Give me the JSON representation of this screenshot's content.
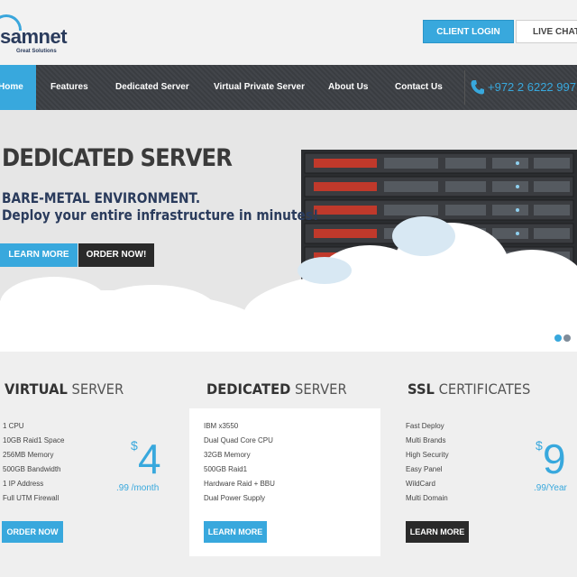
{
  "brand": {
    "name": "samnet",
    "tagline": "Great Solutions"
  },
  "header": {
    "client_login": "CLIENT LOGIN",
    "live_chat": "LIVE CHAT"
  },
  "nav": {
    "items": [
      "Home",
      "Features",
      "Dedicated Server",
      "Virtual Private Server",
      "About Us",
      "Contact Us"
    ],
    "phone": "+972 2 6222 997"
  },
  "hero": {
    "title": "DEDICATED SERVER",
    "subtitle_line1": "BARE-METAL ENVIRONMENT.",
    "subtitle_line2": "Deploy your entire infrastructure in minutes!",
    "learn_more": "LEARN MORE",
    "order_now": "ORDER NOW!",
    "slides": 2,
    "active_slide": 1
  },
  "plans": [
    {
      "title_bold": "VIRTUAL",
      "title_rest": " SERVER",
      "features": [
        "1 CPU",
        "10GB Raid1 Space",
        "256MB Memory",
        "500GB Bandwidth",
        "1 IP Address",
        "Full UTM Firewall"
      ],
      "currency": "$",
      "price": "4",
      "cents": ".99 /month",
      "button": "ORDER NOW",
      "button_color": "#38a8dd"
    },
    {
      "title_bold": "DEDICATED",
      "title_rest": " SERVER",
      "features": [
        "IBM x3550",
        "Dual Quad Core CPU",
        "32GB Memory",
        "500GB Raid1",
        "Hardware Raid + BBU",
        "Dual Power Supply"
      ],
      "button": "LEARN MORE",
      "button_color": "#38a8dd"
    },
    {
      "title_bold": "SSL",
      "title_rest": " CERTIFICATES",
      "features": [
        "Fast Deploy",
        "Multi Brands",
        "High Security",
        "Easy Panel",
        "WildCard",
        "Multi Domain"
      ],
      "currency": "$",
      "price": "9",
      "cents": ".99/Year",
      "button": "LEARN MORE",
      "button_color": "#2a2a2a"
    }
  ],
  "colors": {
    "accent": "#38a8dd",
    "nav_bg": "#3c3f44",
    "dark_button": "#2a2a2a",
    "brand_text": "#2a3b5c"
  }
}
